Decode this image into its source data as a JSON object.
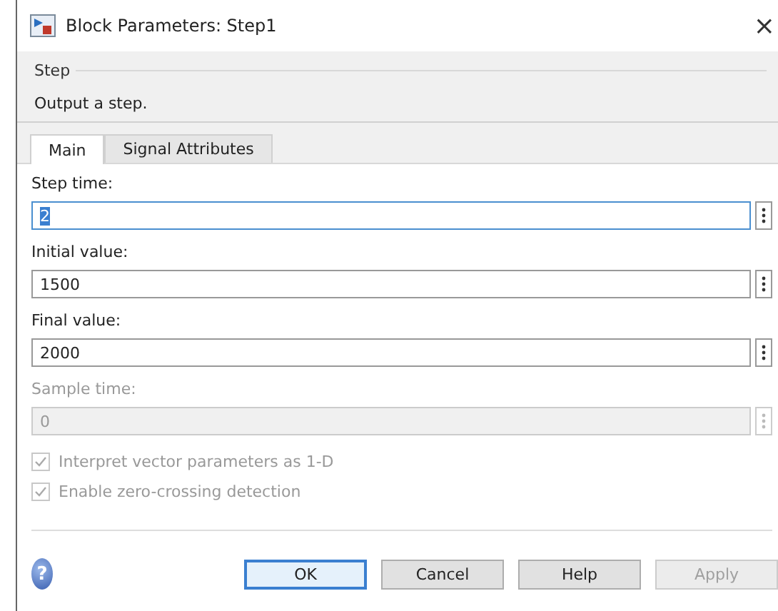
{
  "window": {
    "title": "Block Parameters: Step1",
    "close_glyph": "×"
  },
  "group": {
    "title": "Step",
    "description": "Output a step."
  },
  "tabs": [
    {
      "label": "Main",
      "selected": true
    },
    {
      "label": "Signal Attributes",
      "selected": false
    }
  ],
  "parameters": [
    {
      "label": "Step time:",
      "value": "2",
      "focused": true,
      "disabled": false
    },
    {
      "label": "Initial value:",
      "value": "1500",
      "focused": false,
      "disabled": false
    },
    {
      "label": "Final value:",
      "value": "2000",
      "focused": false,
      "disabled": false
    },
    {
      "label": "Sample time:",
      "value": "0",
      "focused": false,
      "disabled": true
    }
  ],
  "options": [
    {
      "label": "Interpret vector parameters as 1-D",
      "checked": true,
      "disabled": true
    },
    {
      "label": "Enable zero-crossing detection",
      "checked": true,
      "disabled": true
    }
  ],
  "help_glyph": "?",
  "buttons": [
    {
      "label": "OK",
      "default": true,
      "disabled": false
    },
    {
      "label": "Cancel",
      "default": false,
      "disabled": false
    },
    {
      "label": "Help",
      "default": false,
      "disabled": false
    },
    {
      "label": "Apply",
      "default": false,
      "disabled": true
    }
  ]
}
